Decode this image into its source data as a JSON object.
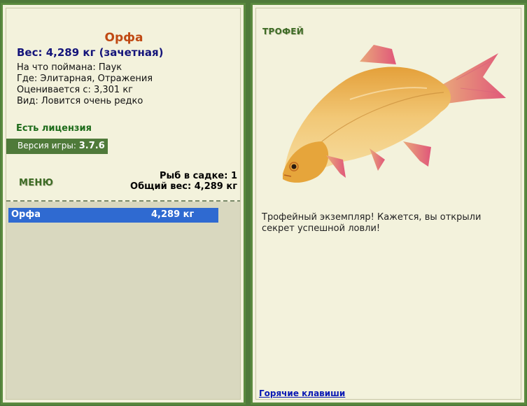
{
  "fish": {
    "name": "Орфа",
    "weight_line": "Вес: 4,289 кг (зачетная)",
    "caught_on": "На что поймана: Паук",
    "where": "Где: Элитарная, Отражения",
    "rated_from": "Оценивается с: 3,301 кг",
    "kind": "Вид: Ловится очень редко"
  },
  "license": "Есть лицензия",
  "version": {
    "label": "Версия игры:",
    "value": "3.7.6"
  },
  "menu_label": "МЕНЮ",
  "keep": {
    "count_line": "Рыб в садке: 1",
    "total_line": "Общий вес: 4,289 кг"
  },
  "catch_list": [
    {
      "name": "Орфа",
      "weight": "4,289 кг"
    }
  ],
  "trophy": {
    "tag": "ТРОФЕЙ",
    "description": "Трофейный экземпляр! Кажется, вы открыли секрет успешной ловли!",
    "image_icon": "golden-ide-fish-image"
  },
  "hotkeys_label": "Горячие клавиши",
  "colors": {
    "frame_green": "#4f7a3a",
    "panel_bg": "#f3f2dc",
    "list_bg": "#d9d8bf",
    "selection_blue": "#2f6ad1",
    "title_orange": "#c04a14",
    "weight_navy": "#14147a",
    "license_green": "#1d6b1a",
    "link_blue": "#0a1ab4"
  }
}
